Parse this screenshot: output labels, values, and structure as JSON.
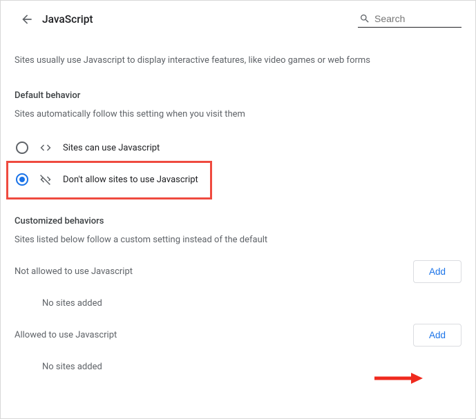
{
  "header": {
    "title": "JavaScript",
    "search_placeholder": "Search"
  },
  "description": "Sites usually use Javascript to display interactive features, like video games or web forms",
  "default_behavior": {
    "title": "Default behavior",
    "subtitle": "Sites automatically follow this setting when you visit them",
    "options": [
      {
        "label": "Sites can use Javascript",
        "selected": false
      },
      {
        "label": "Don't allow sites to use Javascript",
        "selected": true
      }
    ]
  },
  "customized": {
    "title": "Customized behaviors",
    "subtitle": "Sites listed below follow a custom setting instead of the default"
  },
  "lists": {
    "not_allowed": {
      "title": "Not allowed to use Javascript",
      "add_label": "Add",
      "empty": "No sites added"
    },
    "allowed": {
      "title": "Allowed to use Javascript",
      "add_label": "Add",
      "empty": "No sites added"
    }
  }
}
